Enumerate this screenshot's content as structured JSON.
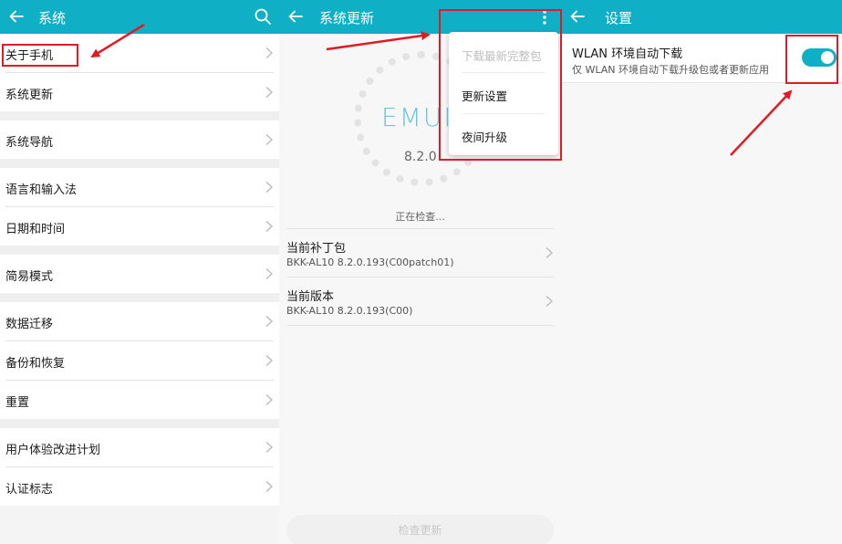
{
  "colors": {
    "accent": "#0fb0c6",
    "annotation_red": "#e01b22"
  },
  "panel1": {
    "title": "系统",
    "back_icon": "arrow-left-icon",
    "search_icon": "search-icon",
    "groups": [
      [
        "关于手机",
        "系统更新"
      ],
      [
        "系统导航"
      ],
      [
        "语言和输入法",
        "日期和时间"
      ],
      [
        "简易模式"
      ],
      [
        "数据迁移",
        "备份和恢复",
        "重置"
      ],
      [
        "用户体验改进计划",
        "认证标志"
      ]
    ]
  },
  "panel2": {
    "title": "系统更新",
    "emui_logo": "EMUI",
    "version": "8.2.0",
    "status": "正在检查...",
    "items": [
      {
        "title": "当前补丁包",
        "subtitle": "BKK-AL10 8.2.0.193(C00patch01)"
      },
      {
        "title": "当前版本",
        "subtitle": "BKK-AL10 8.2.0.193(C00)"
      }
    ],
    "check_button": "检查更新",
    "menu": {
      "items": [
        {
          "label": "下载最新完整包",
          "disabled": true
        },
        {
          "label": "更新设置",
          "disabled": false
        },
        {
          "label": "夜间升级",
          "disabled": false
        }
      ]
    }
  },
  "panel3": {
    "title": "设置",
    "setting": {
      "title": "WLAN 环境自动下载",
      "subtitle": "仅 WLAN 环境自动下载升级包或者更新应用",
      "enabled": true
    }
  }
}
